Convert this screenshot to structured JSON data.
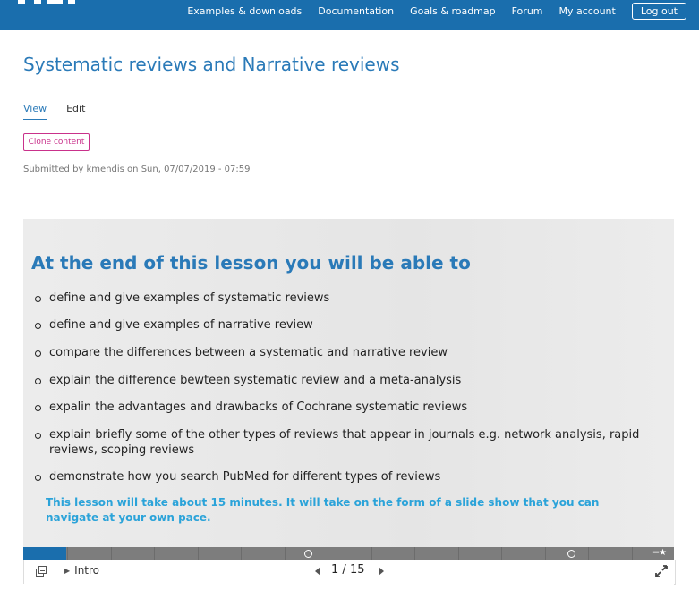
{
  "nav": {
    "items": [
      "Examples & downloads",
      "Documentation",
      "Goals & roadmap",
      "Forum",
      "My account"
    ],
    "logout": "Log out"
  },
  "page": {
    "title": "Systematic reviews and Narrative reviews",
    "tabs": [
      "View",
      "Edit"
    ],
    "clone": "Clone content",
    "submitted": "Submitted by kmendis on Sun, 07/07/2019 - 07:59"
  },
  "slide": {
    "heading": "At the end of this lesson you will be able to",
    "objectives": [
      "define and give examples of systematic reviews",
      "define and give examples of narrative review",
      "compare the differences between a systematic and narrative review",
      "explain the difference bewteen systematic review and a meta-analysis",
      "expalin the advantages and drawbacks of  Cochrane systematic reviews",
      "explain briefly some of the other types of reviews that appear in journals e.g. network analysis, rapid reviews, scoping reviews",
      "demonstrate how you search PubMed for different types of reviews"
    ],
    "note": "This lesson will take about 15 minutes. It will take on the form of a slide show that you can navigate at your own pace."
  },
  "player": {
    "slide_name": "Intro",
    "current": "1",
    "separator": "/",
    "total": "15",
    "progress_fraction": 0.0667,
    "accent": "#1a6ead"
  },
  "icons": [
    "menu-icon",
    "previous-icon",
    "next-icon",
    "fullscreen-icon",
    "star-icon"
  ]
}
